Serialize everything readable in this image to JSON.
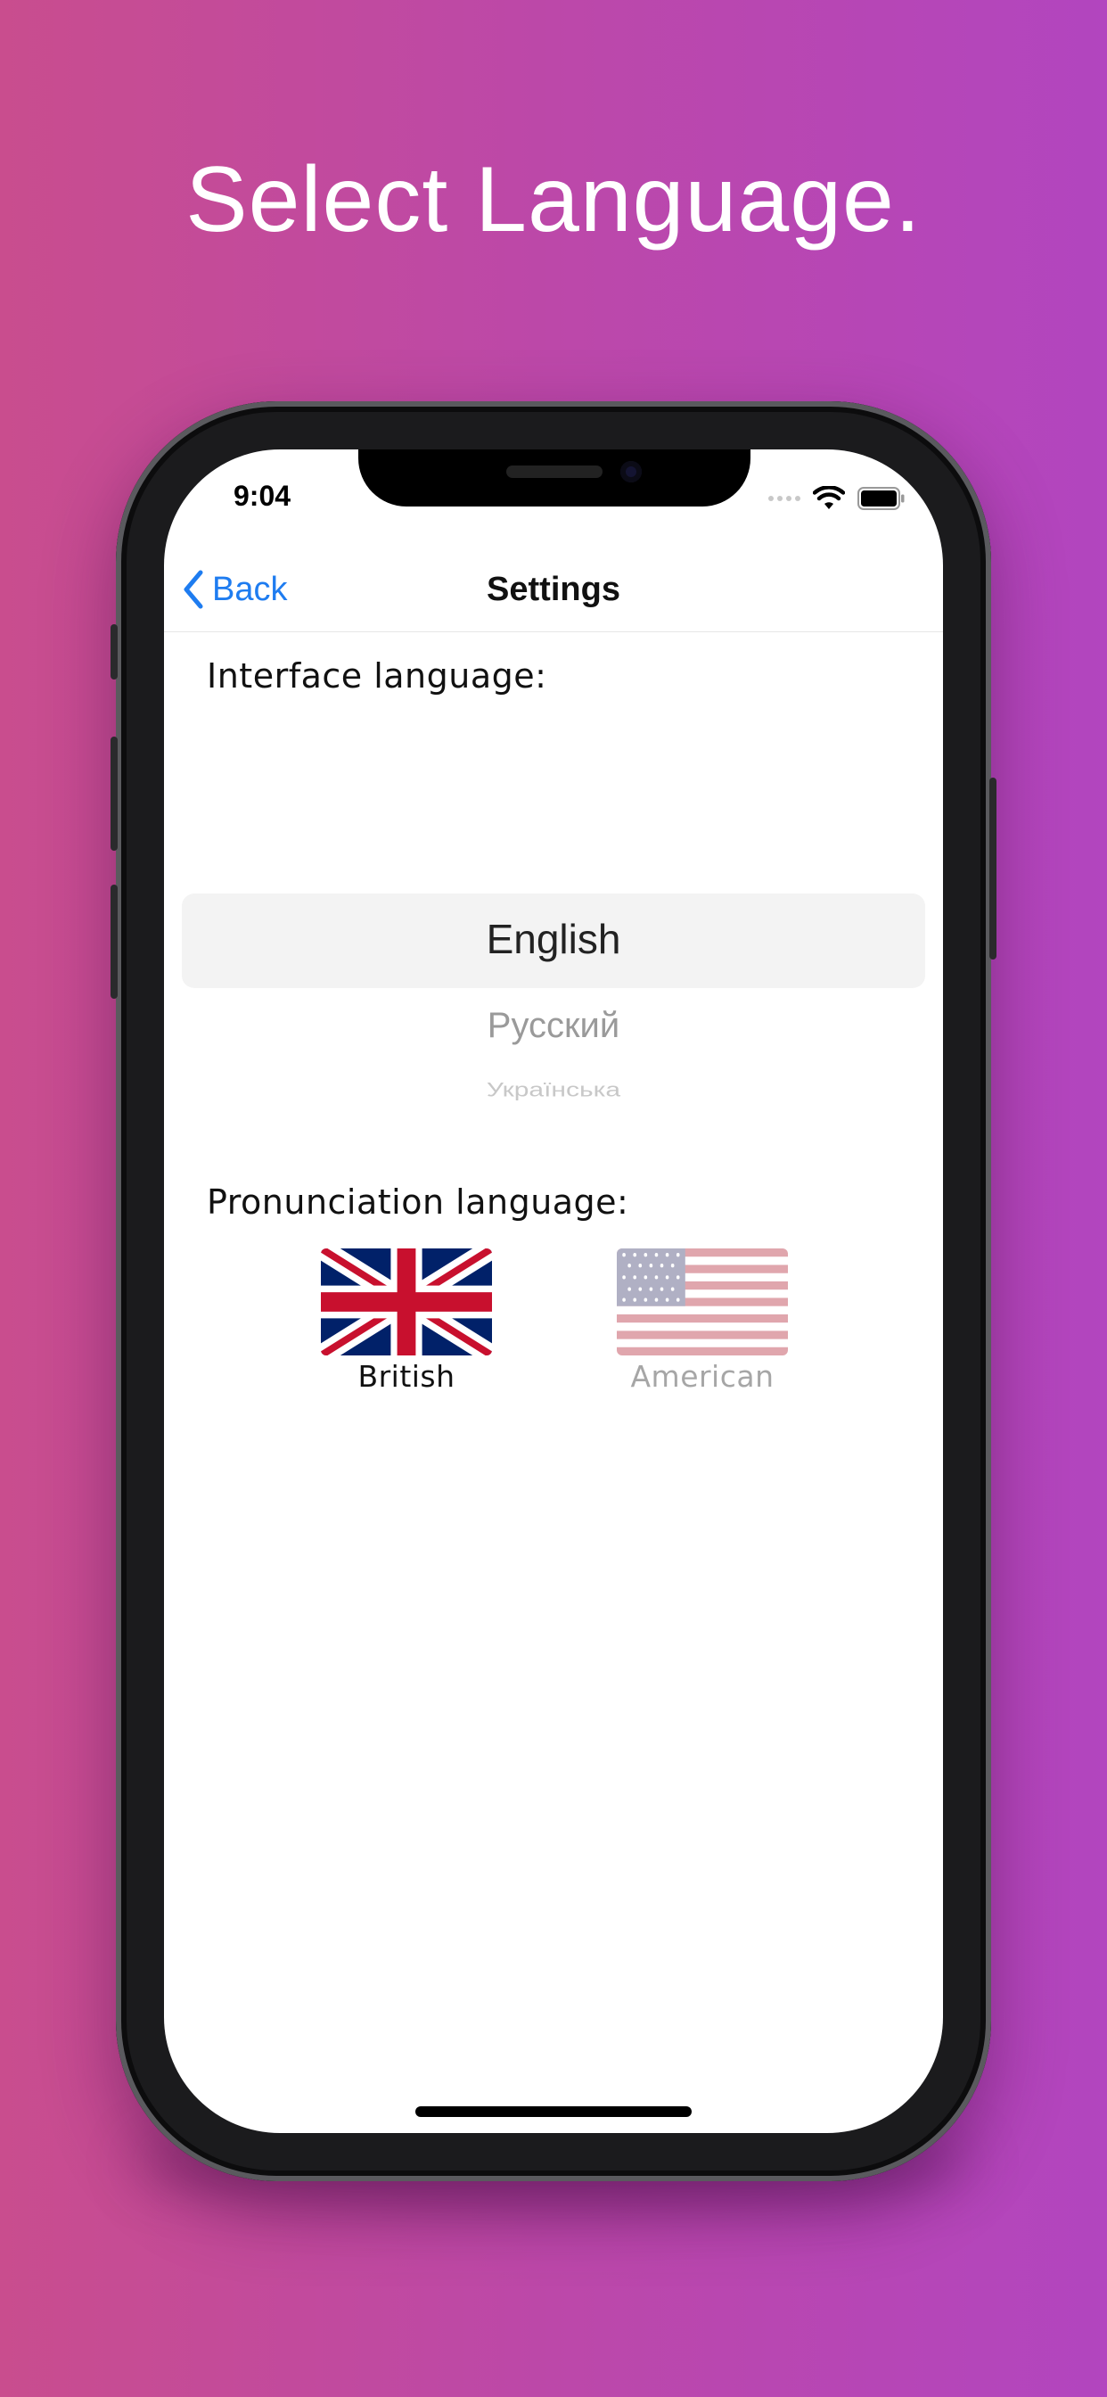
{
  "headline": "Select Language.",
  "status_bar": {
    "time": "9:04"
  },
  "nav": {
    "back_label": "Back",
    "title": "Settings"
  },
  "interface_language": {
    "label": "Interface language:",
    "options": [
      "English",
      "Русский",
      "Українська"
    ],
    "selected": "English"
  },
  "pronunciation_language": {
    "label": "Pronunciation language:",
    "options": [
      {
        "label": "British",
        "icon": "uk-flag-icon",
        "selected": true
      },
      {
        "label": "American",
        "icon": "us-flag-icon",
        "selected": false
      }
    ]
  },
  "colors": {
    "accent": "#1E7CF0",
    "background_gradient": [
      "#C94D8E",
      "#B245BF"
    ]
  }
}
